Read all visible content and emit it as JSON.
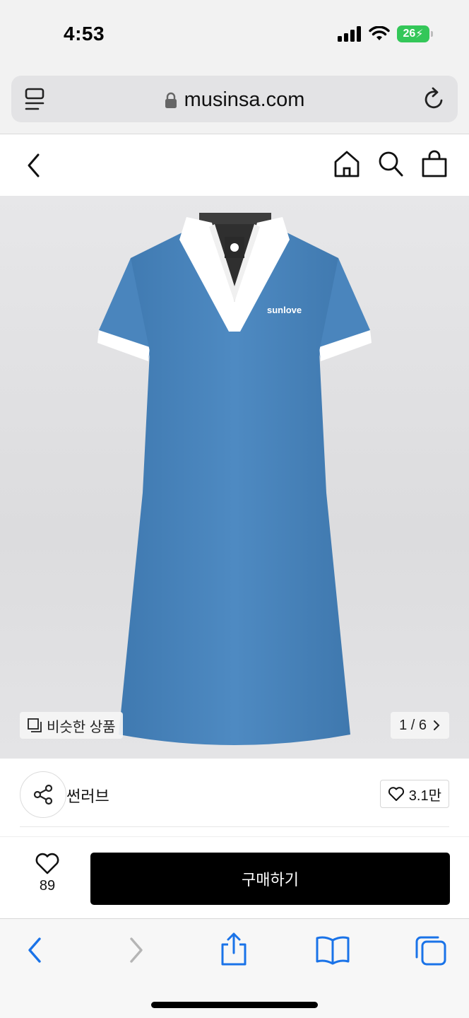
{
  "status_bar": {
    "time": "4:53",
    "battery_level": "26"
  },
  "url_bar": {
    "url": "musinsa.com"
  },
  "product_image": {
    "similar_label": "비슷한 상품",
    "pager": "1 / 6",
    "logo_text": "sunlove"
  },
  "brand": {
    "name": "썬러브",
    "wish_count": "3.1만"
  },
  "buy_bar": {
    "like_count": "89",
    "buy_label": "구매하기"
  },
  "colors": {
    "dress": "#4a85bd",
    "collar": "#ffffff",
    "buy_button": "#000000",
    "safari_accent": "#1a73e8"
  },
  "icons": [
    "signal-icon",
    "wifi-icon",
    "battery-icon",
    "reader-icon",
    "lock-icon",
    "reload-icon",
    "back-icon",
    "home-icon",
    "search-icon",
    "bag-icon",
    "gallery-icon",
    "chevron-right-icon",
    "share-icon",
    "heart-icon",
    "safari-back-icon",
    "safari-forward-icon",
    "safari-share-icon",
    "bookmarks-icon",
    "tabs-icon"
  ]
}
